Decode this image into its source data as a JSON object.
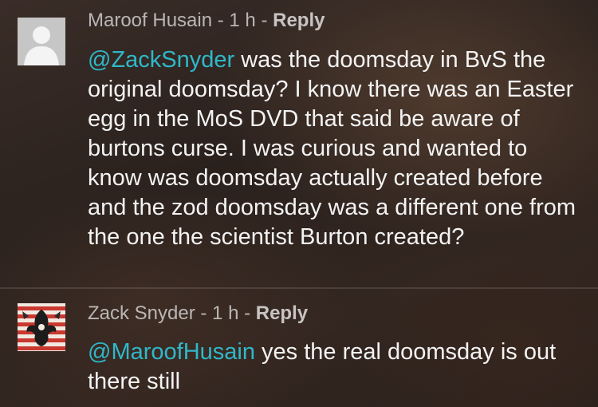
{
  "comments": [
    {
      "author": "Maroof Husain",
      "separator": " - ",
      "time": "1 h",
      "reply_label": "Reply",
      "mention": "@ZackSnyder",
      "text": " was the doomsday in BvS the original doomsday? I know there was an Easter egg in the MoS DVD that said be aware of burtons curse. I was curious and wanted to know was doomsday actually created before and the zod doomsday was a different one from the one the scientist Burton created?"
    },
    {
      "author": "Zack Snyder",
      "separator": " - ",
      "time": "1 h",
      "reply_label": "Reply",
      "mention": "@MaroofHusain",
      "text": " yes the real doomsday is out there still"
    }
  ],
  "colors": {
    "mention": "#2fb8c9",
    "text": "#f3f3f3",
    "meta": "#bdbdbd"
  }
}
